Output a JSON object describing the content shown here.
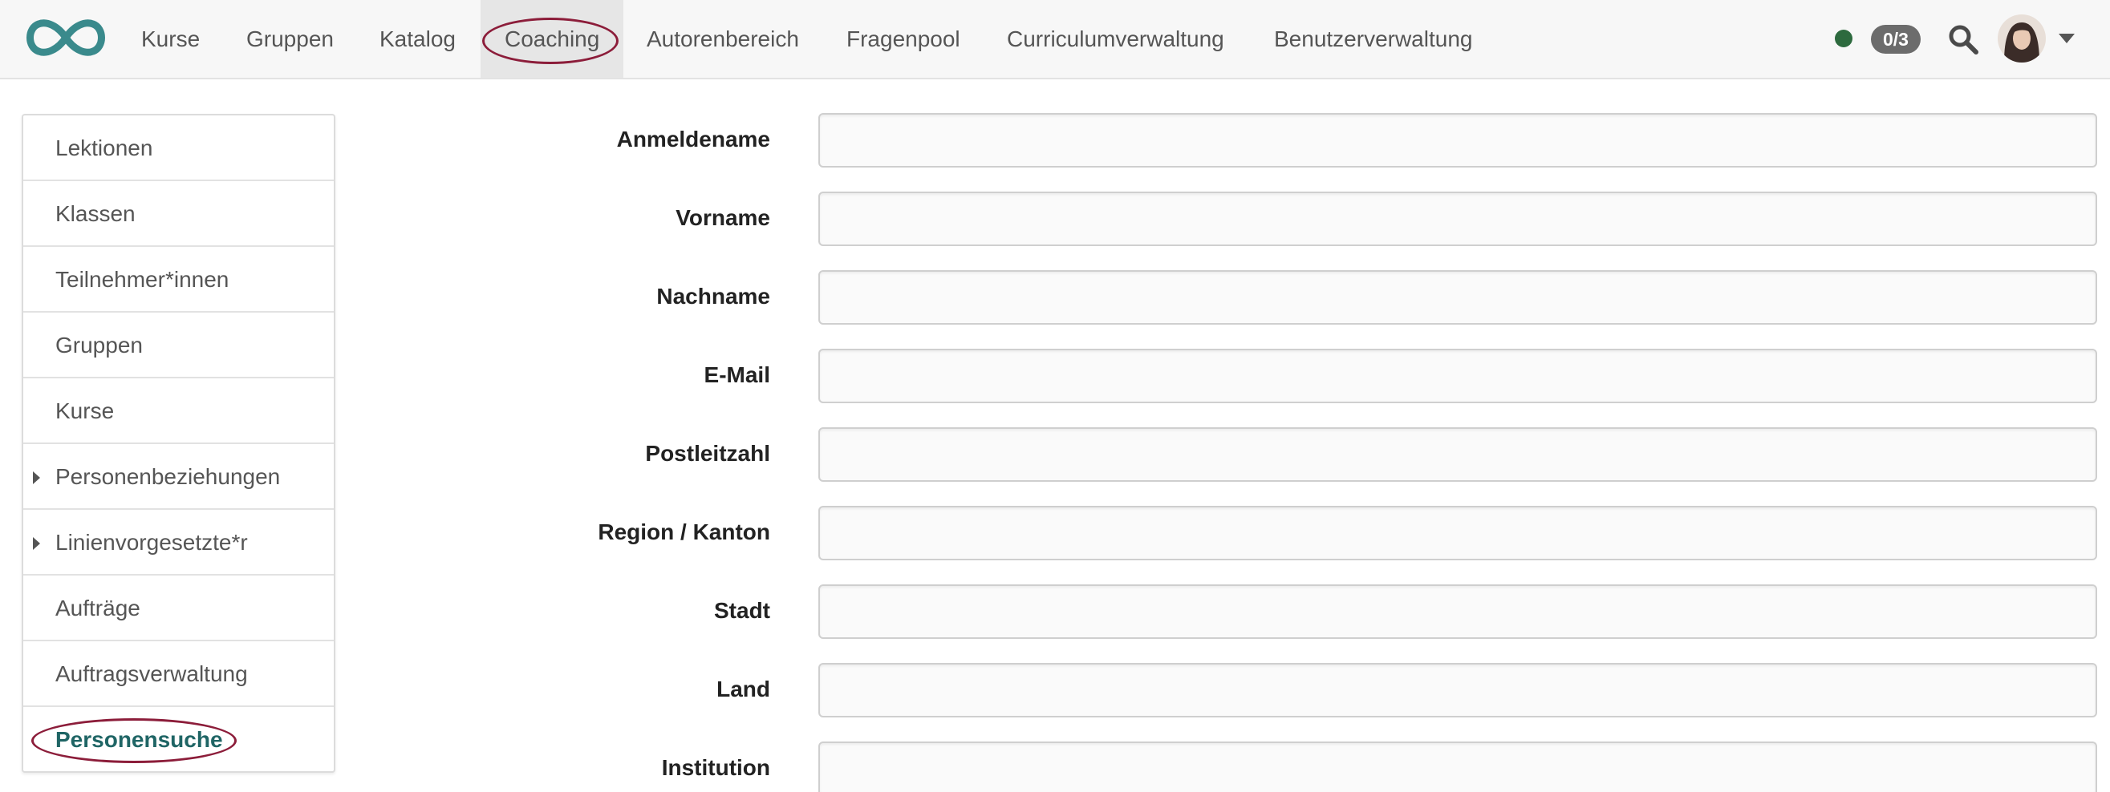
{
  "header": {
    "logo_icon": "infinity-logo-icon",
    "nav": [
      {
        "label": "Kurse"
      },
      {
        "label": "Gruppen"
      },
      {
        "label": "Katalog"
      },
      {
        "label": "Coaching",
        "active": true,
        "highlighted": true
      },
      {
        "label": "Autorenbereich"
      },
      {
        "label": "Fragenpool"
      },
      {
        "label": "Curriculumverwaltung"
      },
      {
        "label": "Benutzerverwaltung"
      }
    ],
    "status_color": "#2d6a3e",
    "badge": "0/3",
    "search_icon": "search-icon",
    "avatar_icon": "user-avatar",
    "menu_icon": "caret-down-icon"
  },
  "sidebar": {
    "items": [
      {
        "label": "Lektionen"
      },
      {
        "label": "Klassen"
      },
      {
        "label": "Teilnehmer*innen"
      },
      {
        "label": "Gruppen"
      },
      {
        "label": "Kurse"
      },
      {
        "label": "Personenbeziehungen",
        "expandable": true
      },
      {
        "label": "Linienvorgesetzte*r",
        "expandable": true
      },
      {
        "label": "Aufträge"
      },
      {
        "label": "Auftragsverwaltung"
      },
      {
        "label": "Personensuche",
        "active": true,
        "highlighted": true
      }
    ]
  },
  "form": {
    "fields": [
      {
        "label": "Anmeldename",
        "value": ""
      },
      {
        "label": "Vorname",
        "value": ""
      },
      {
        "label": "Nachname",
        "value": ""
      },
      {
        "label": "E-Mail",
        "value": ""
      },
      {
        "label": "Postleitzahl",
        "value": ""
      },
      {
        "label": "Region / Kanton",
        "value": ""
      },
      {
        "label": "Stadt",
        "value": ""
      },
      {
        "label": "Land",
        "value": ""
      },
      {
        "label": "Institution",
        "value": ""
      }
    ]
  },
  "colors": {
    "accent": "#1f6565",
    "highlight": "#8c1d3a",
    "logo": "#3a8a8c"
  }
}
